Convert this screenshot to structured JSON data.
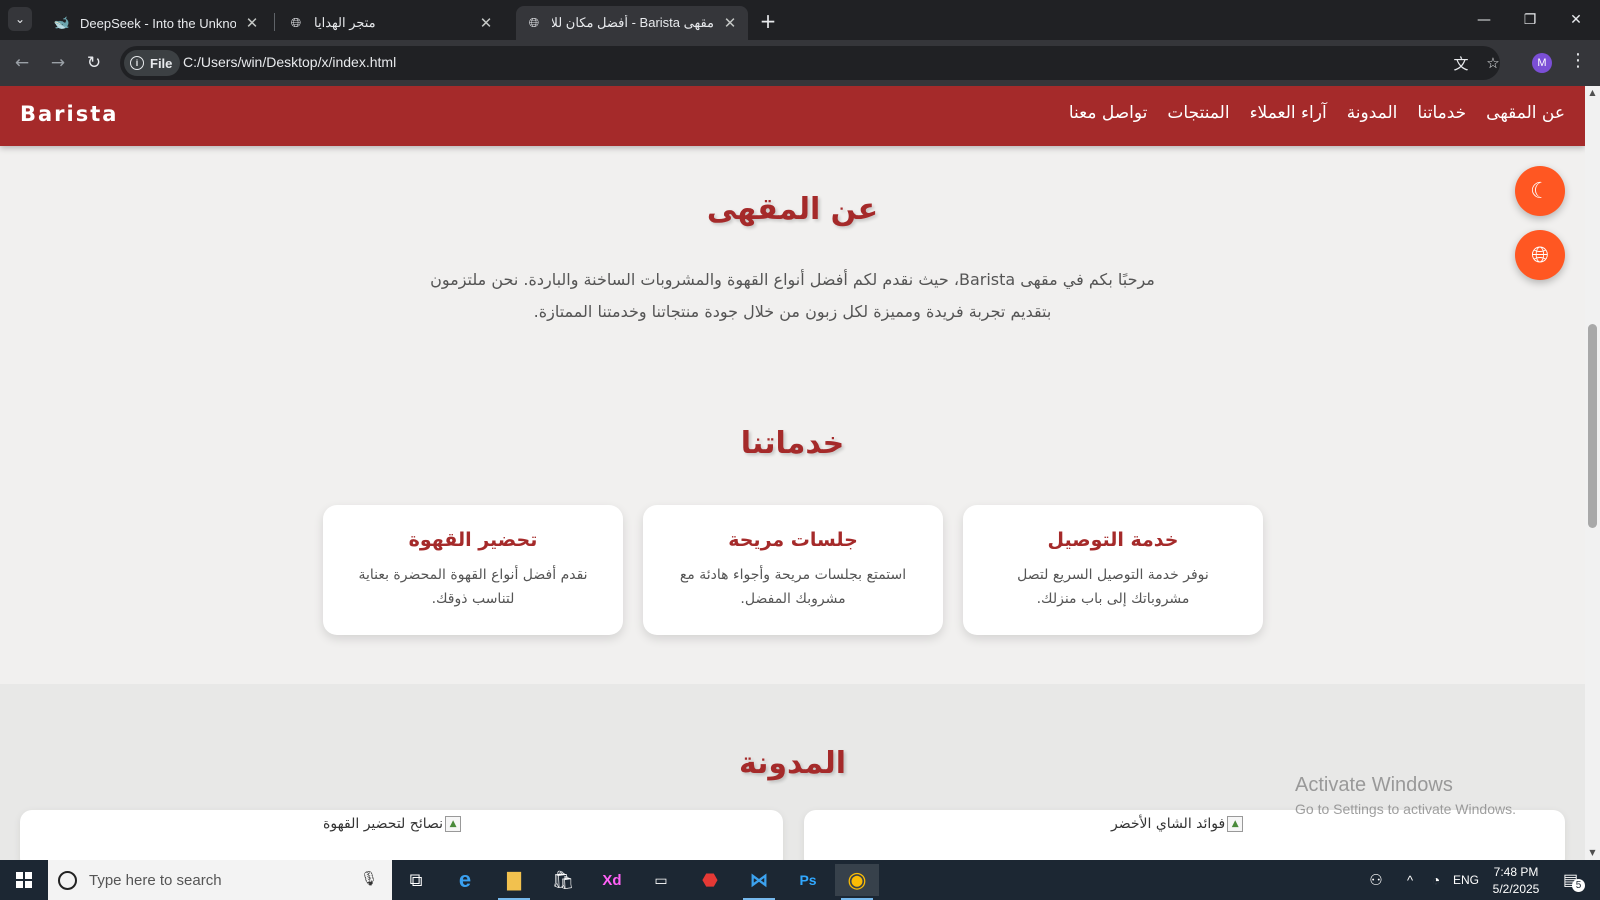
{
  "browser": {
    "tabs": [
      {
        "title": "DeepSeek - Into the Unknown",
        "favicon": "deepseek-whale-icon",
        "active": false
      },
      {
        "title": "متجر الهدايا",
        "favicon": "globe-icon",
        "active": false
      },
      {
        "title": "مقهى Barista - أفضل مكان للاستـ",
        "favicon": "globe-icon",
        "active": true
      }
    ],
    "url_chip": "File",
    "url": "C:/Users/win/Desktop/x/index.html",
    "profile_initial": "M"
  },
  "site": {
    "brand": "Barista",
    "nav": [
      "تواصل معنا",
      "المنتجات",
      "آراء العملاء",
      "المدونة",
      "خدماتنا",
      "عن المقهى"
    ],
    "about": {
      "title": "عن المقهى",
      "line1": "مرحبًا بكم في مقهى Barista، حيث نقدم لكم أفضل أنواع القهوة والمشروبات الساخنة والباردة. نحن ملتزمون",
      "line2": "بتقديم تجربة فريدة ومميزة لكل زبون من خلال جودة منتجاتنا وخدمتنا الممتازة."
    },
    "services": {
      "title": "خدماتنا",
      "items": [
        {
          "title": "خدمة التوصيل",
          "text": "نوفر خدمة التوصيل السريع لتصل مشروباتك إلى باب منزلك."
        },
        {
          "title": "جلسات مريحة",
          "text": "استمتع بجلسات مريحة وأجواء هادئة مع مشروبك المفضل."
        },
        {
          "title": "تحضير القهوة",
          "text": "نقدم أفضل أنواع القهوة المحضرة بعناية لتناسب ذوقك."
        }
      ]
    },
    "blog": {
      "title": "المدونة",
      "images": [
        "فوائد الشاي الأخضر",
        "نصائح لتحضير القهوة"
      ]
    },
    "accent": "#a52a2a",
    "fab_color": "#ff5722"
  },
  "watermark": {
    "line1": "Activate Windows",
    "line2": "Go to Settings to activate Windows."
  },
  "taskbar": {
    "search_placeholder": "Type here to search",
    "language": "ENG",
    "time": "7:48 PM",
    "date": "5/2/2025",
    "notification_count": "5",
    "xd_label": "Xd",
    "ps_label": "Ps"
  }
}
